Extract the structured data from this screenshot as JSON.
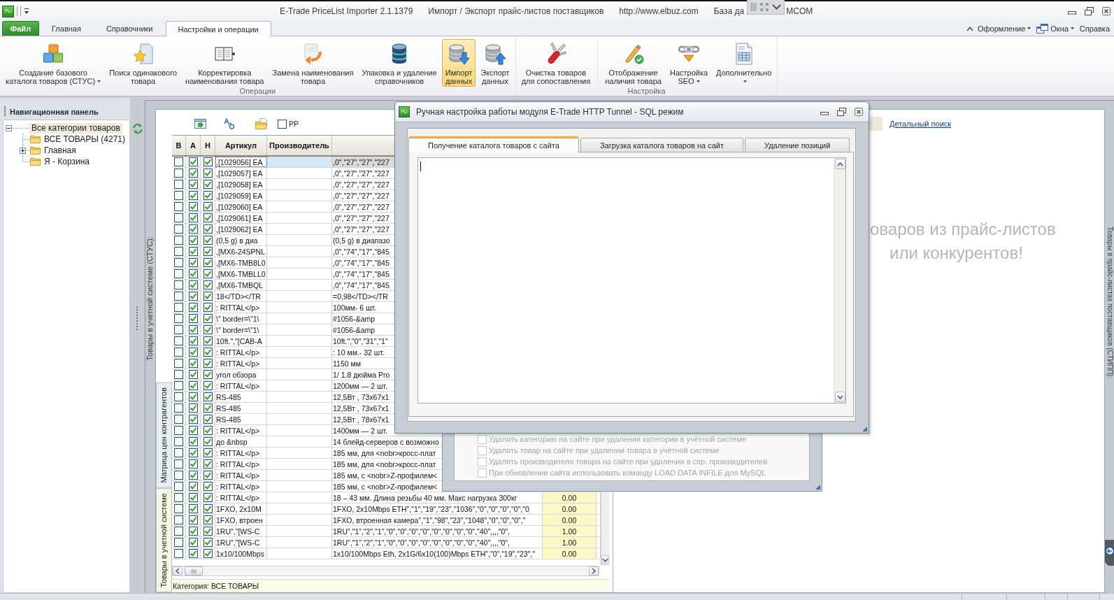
{
  "window": {
    "logo": "PLi",
    "title_parts": [
      "E-Trade PriceList Importer 2.1.1379",
      "Импорт / Экспорт прайс-листов поставщиков",
      "http://www.elbuz.com",
      "База да",
      "MCOM"
    ]
  },
  "ribbon_tabs": [
    {
      "label": "Файл",
      "kind": "file",
      "selected": false
    },
    {
      "label": "Главная",
      "kind": "tab",
      "selected": false
    },
    {
      "label": "Справочники",
      "kind": "tab",
      "selected": false
    },
    {
      "label": "Настройки и операции",
      "kind": "tab",
      "selected": true
    }
  ],
  "ribbon_menu": [
    {
      "label": "Оформление",
      "dropdown": true
    },
    {
      "label": "Окна",
      "dropdown": true
    },
    {
      "label": "Справка",
      "dropdown": false
    }
  ],
  "ribbon_groups": [
    {
      "label": "Операции",
      "sections": [
        [
          {
            "lines": [
              "Создание базового",
              "каталога товаров (СТУС)"
            ],
            "dropdown": true,
            "selected": false
          },
          {
            "lines": [
              "Поиск одинакового",
              "товара"
            ],
            "dropdown": false,
            "selected": false
          },
          {
            "lines": [
              "Корректировка",
              "наименования товара"
            ],
            "dropdown": false,
            "selected": false
          },
          {
            "lines": [
              "Замена наименования",
              "товара"
            ],
            "dropdown": false,
            "selected": false
          },
          {
            "lines": [
              "Упаковка и удаление",
              "справочников"
            ],
            "dropdown": false,
            "selected": false
          },
          {
            "lines": [
              "Импорт",
              "данных"
            ],
            "dropdown": false,
            "selected": true
          },
          {
            "lines": [
              "Экспорт",
              "данных"
            ],
            "dropdown": false,
            "selected": false
          }
        ]
      ]
    },
    {
      "label": "Настройка",
      "sections": [
        [
          {
            "lines": [
              "Очистка товаров",
              "для сопоставления"
            ],
            "dropdown": false,
            "selected": false
          }
        ],
        [
          {
            "lines": [
              "Отображение",
              "наличия товара"
            ],
            "dropdown": false,
            "selected": false
          },
          {
            "lines": [
              "Настройка",
              "SEO"
            ],
            "dropdown": true,
            "selected": false
          },
          {
            "lines": [
              "Дополнительно"
            ],
            "dropdown": true,
            "selected": false
          }
        ]
      ]
    }
  ],
  "navigation_panel": {
    "title": "Навигационная панель",
    "tree": [
      {
        "label": "Все категории товаров",
        "expanded": true,
        "selected": true,
        "children": [
          {
            "label": "ВСЕ ТОВАРЫ (4271)",
            "selected": false
          },
          {
            "label": "Главная",
            "expanded": false,
            "selected": false
          },
          {
            "label": "Я - Корзина",
            "selected": false
          }
        ]
      }
    ]
  },
  "table_panel": {
    "side_label": "Товары в учетной системе (СТУС):",
    "toolbar_checkbox": {
      "label": "PP",
      "checked": false
    },
    "columns": [
      "В",
      "А",
      "Н",
      "Артикул",
      "Производитель"
    ],
    "rows": [
      {
        "selected": true,
        "checks": [
          false,
          true,
          true
        ],
        "article": ",[1029056] EA",
        "column_6": ",0\",\"27\",\"27\",\"227"
      },
      {
        "selected": false,
        "checks": [
          false,
          true,
          true
        ],
        "article": ",[1029057] EA",
        "column_6": ",0\",\"27\",\"27\",\"227"
      },
      {
        "selected": false,
        "checks": [
          false,
          true,
          true
        ],
        "article": ",[1029058] EA",
        "column_6": ",0\",\"27\",\"27\",\"227"
      },
      {
        "selected": false,
        "checks": [
          false,
          true,
          true
        ],
        "article": ",[1029059] EA",
        "column_6": ",0\",\"27\",\"27\",\"227"
      },
      {
        "selected": false,
        "checks": [
          false,
          true,
          true
        ],
        "article": ",[1029060] EA",
        "column_6": ",0\",\"27\",\"27\",\"227"
      },
      {
        "selected": false,
        "checks": [
          false,
          true,
          true
        ],
        "article": ",[1029061] EA",
        "column_6": ",0\",\"27\",\"27\",\"227"
      },
      {
        "selected": false,
        "checks": [
          false,
          true,
          true
        ],
        "article": ",[1029062] EA",
        "column_6": ",0\",\"27\",\"27\",\"227"
      },
      {
        "selected": false,
        "checks": [
          false,
          true,
          true
        ],
        "article": "(0,5 g) в диа",
        "column_6": "(0,5 g) в диапазо"
      },
      {
        "selected": false,
        "checks": [
          false,
          true,
          true
        ],
        "article": ",[MX6-24SPNL",
        "column_6": ",0\",\"74\",\"17\",\"845"
      },
      {
        "selected": false,
        "checks": [
          false,
          true,
          true
        ],
        "article": ",[MX6-TMB8L0",
        "column_6": ",0\",\"74\",\"17\",\"845"
      },
      {
        "selected": false,
        "checks": [
          false,
          true,
          true
        ],
        "article": ",[MX6-TMBLL0",
        "column_6": ",0\",\"74\",\"17\",\"845"
      },
      {
        "selected": false,
        "checks": [
          false,
          true,
          true
        ],
        "article": ",[MX6-TMBQL",
        "column_6": ",0\",\"74\",\"17\",\"845"
      },
      {
        "selected": false,
        "checks": [
          false,
          true,
          true
        ],
        "article": "18</TD></TR",
        "column_6": "=0,98</TD></TR"
      },
      {
        "selected": false,
        "checks": [
          false,
          true,
          true
        ],
        "article": ": RITTAL</p>",
        "column_6": "100мм- 6 шт."
      },
      {
        "selected": false,
        "checks": [
          false,
          true,
          true
        ],
        "article": "\\\" border=\\\"1\\",
        "column_6": "#1056-&amp"
      },
      {
        "selected": false,
        "checks": [
          false,
          true,
          true
        ],
        "article": "\\\" border=\\\"1\\",
        "column_6": "#1056-&amp"
      },
      {
        "selected": false,
        "checks": [
          false,
          true,
          true
        ],
        "article": "10ft.\",\"[CAB-A",
        "column_6": "10ft.\",\"0\",\"31\",\"1\""
      },
      {
        "selected": false,
        "checks": [
          false,
          true,
          true
        ],
        "article": ": RITTAL</p>",
        "column_6": ": 10 мм.- 32 шт."
      },
      {
        "selected": false,
        "checks": [
          false,
          true,
          true
        ],
        "article": ": RITTAL</p>",
        "column_6": "1150 мм"
      },
      {
        "selected": false,
        "checks": [
          false,
          true,
          true
        ],
        "article": "угол обзора",
        "column_6": "1/ 1.8 дюйма Pro"
      },
      {
        "selected": false,
        "checks": [
          false,
          true,
          true
        ],
        "article": ": RITTAL</p>",
        "column_6": "1200мм — 2 шт."
      },
      {
        "selected": false,
        "checks": [
          false,
          true,
          true
        ],
        "article": "RS-485",
        "column_6": "12,5Вт , 73х67х1"
      },
      {
        "selected": false,
        "checks": [
          false,
          true,
          true
        ],
        "article": "RS-485",
        "column_6": "12,5Вт , 73х67х1"
      },
      {
        "selected": false,
        "checks": [
          false,
          true,
          true
        ],
        "article": "RS-485",
        "column_6": "12,5Вт , 78х67х1"
      },
      {
        "selected": false,
        "checks": [
          false,
          true,
          true
        ],
        "article": ": RITTAL</p>",
        "column_6": "1400мм — 2 шт."
      },
      {
        "selected": false,
        "checks": [
          false,
          true,
          true
        ],
        "article": "до &nbsp",
        "column_6": "14 блейд-серверов с возможно"
      },
      {
        "selected": false,
        "checks": [
          false,
          true,
          true
        ],
        "article": ": RITTAL</p>",
        "column_6": "185 мм, для <nobr>кросс-плат"
      },
      {
        "selected": false,
        "checks": [
          false,
          true,
          true
        ],
        "article": ": RITTAL</p>",
        "column_6": "185 мм, для <nobr>кросс-плат"
      },
      {
        "selected": false,
        "checks": [
          false,
          true,
          true
        ],
        "article": ": RITTAL</p>",
        "column_6": "185 мм, с <nobr>Z-профилем<"
      },
      {
        "selected": false,
        "checks": [
          false,
          true,
          true
        ],
        "article": ": RITTAL</p>",
        "column_6": "185 мм, с <nobr>Z-профилем<"
      },
      {
        "selected": false,
        "checks": [
          false,
          true,
          true
        ],
        "article": ": RITTAL</p>",
        "column_6": "18 – 43 мм. Длина резьбы 40 мм. Макс нагрузка 300кг",
        "column_7": "0.00"
      },
      {
        "selected": false,
        "checks": [
          false,
          true,
          true
        ],
        "article": "1FXO, 2x10M",
        "column_6": "1FXO, 2x10Mbps ETH\",\"1\",\"19\",\"23\",\"1036\",\"0\",\"0\",\"0\",\"0\",\"0",
        "column_7": "0.00"
      },
      {
        "selected": false,
        "checks": [
          false,
          true,
          true
        ],
        "article": "1FXO, втроен",
        "column_6": "1FXO, втроенная камера\",\"1\",\"98\",\"23\",\"1048\",\"0\",\"0\",\"0\",\"",
        "column_7": "0.00"
      },
      {
        "selected": false,
        "checks": [
          false,
          true,
          true
        ],
        "article": "1RU\",\"[WS-C",
        "column_6": "1RU\",\"1\",\"2\",\"1\",\"0\",\"0\",\"0\",\"0\",\"0\",\"0\",\"0\",\"0\",\"40\",,,,\"0\",",
        "column_7": "1.00"
      },
      {
        "selected": false,
        "checks": [
          false,
          true,
          true
        ],
        "article": "1RU\",\"[WS-C",
        "column_6": "1RU\",\"1\",\"2\",\"1\",\"0\",\"0\",\"0\",\"0\",\"0\",\"0\",\"0\",\"0\",\"40\",,,,\"0\",",
        "column_7": "1.00"
      },
      {
        "selected": false,
        "checks": [
          false,
          true,
          true
        ],
        "article": "1x10/100Mbps",
        "column_6": "1x10/100Mbps Eth, 2x1G/6x10(100)Mbps ETH\",\"0\",\"19\",\"23\",\"",
        "column_7": "0.00"
      }
    ],
    "status": "Категория: ВСЕ ТОВАРЫ",
    "view_tabs": [
      {
        "label": "Матрица цен контрагентов",
        "selected": false
      },
      {
        "label": "Товары в учетной системе",
        "selected": true
      }
    ]
  },
  "search_panel": {
    "link": "Детальный поиск",
    "message_lines": [
      "оваров из прайс-листов",
      "или конкурентов!"
    ],
    "side_label": "Товары в прайс-листах поставщиков (СТИПП):"
  },
  "dialog": {
    "logo": "PLi",
    "title": "Ручная настройка работы модуля E-Trade HTTP Tunnel - SQL режим",
    "tabs": [
      {
        "label": "Получение каталога товаров с сайта",
        "selected": true
      },
      {
        "label": "Загрузка каталога товаров на сайт",
        "selected": false
      },
      {
        "label": "Удаление позиций",
        "selected": false
      }
    ],
    "text_area": {
      "focused": true
    }
  },
  "background_window": {
    "options": [
      {
        "label": "Удалять категорию на сайте при удалении категории в учётной системе",
        "checked": false,
        "disabled": true
      },
      {
        "label": "Удалять товар на сайте при удалении товара в учётной системе",
        "checked": false,
        "disabled": true
      },
      {
        "label": "Удалять производителя товара на сайте при удалении в спр. производителей",
        "checked": false,
        "disabled": true
      },
      {
        "label": "При обновлении сайта использовать команду LOAD DATA INFILE для MySQL",
        "checked": false,
        "disabled": true
      }
    ]
  }
}
